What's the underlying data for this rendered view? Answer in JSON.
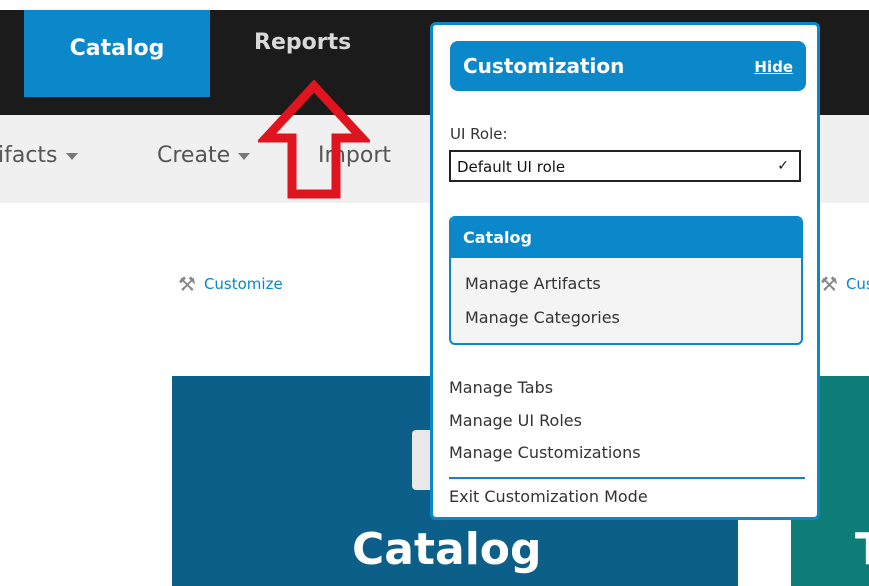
{
  "nav": {
    "catalog": "Catalog",
    "reports": "Reports"
  },
  "subnav": {
    "artifacts": "ifacts",
    "create": "Create",
    "import": "Import"
  },
  "customize": {
    "left": "Customize",
    "right": "Cus"
  },
  "tiles": {
    "catalog_title": "Catalog",
    "teal_title": "T"
  },
  "popup": {
    "title": "Customization",
    "hide": "Hide",
    "role_label": "UI Role:",
    "role_value": "Default UI role",
    "catalog_section": {
      "title": "Catalog",
      "items": [
        "Manage Artifacts",
        "Manage Categories"
      ]
    },
    "items": [
      "Manage Tabs",
      "Manage UI Roles",
      "Manage Customizations"
    ],
    "exit": "Exit Customization Mode"
  },
  "colors": {
    "accent": "#0a88c9",
    "arrow": "#e0141f",
    "tile_dark": "#0b5f88",
    "tile_teal": "#0e7d78"
  },
  "icons": {
    "wrench": "wrench-icon",
    "chevron": "chevron-down-icon",
    "caret": "caret-down-icon"
  }
}
